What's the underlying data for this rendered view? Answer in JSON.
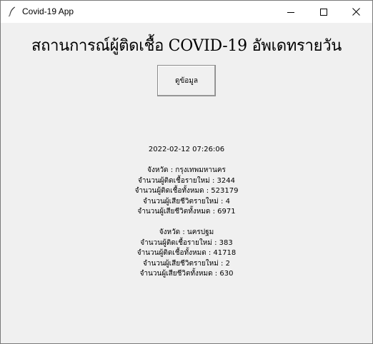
{
  "window": {
    "title": "Covid-19 App",
    "controls": {
      "minimize": "minimize-icon",
      "maximize": "maximize-icon",
      "close": "close-icon"
    }
  },
  "main": {
    "heading": "สถานการณ์ผู้ติดเชื้อ COVID-19 อัพเดทรายวัน",
    "view_button_label": "ดูข้อมูล",
    "timestamp": "2022-02-12 07:26:06",
    "provinces": [
      {
        "province_line": "จังหวัด : กรุงเทพมหานคร",
        "new_cases_line": "จำนวนผู้ติดเชื้อรายใหม่ : 3244",
        "total_cases_line": "จำนวนผู้ติดเชื้อทั้งหมด : 523179",
        "new_deaths_line": "จำนวนผู้เสียชีวิตรายใหม่ : 4",
        "total_deaths_line": "จำนวนผู้เสียชีวิตทั้งหมด : 6971"
      },
      {
        "province_line": "จังหวัด : นครปฐม",
        "new_cases_line": "จำนวนผู้ติดเชื้อรายใหม่ : 383",
        "total_cases_line": "จำนวนผู้ติดเชื้อทั้งหมด : 41718",
        "new_deaths_line": "จำนวนผู้เสียชีวิตรายใหม่ : 2",
        "total_deaths_line": "จำนวนผู้เสียชีวิตทั้งหมด : 630"
      }
    ]
  }
}
